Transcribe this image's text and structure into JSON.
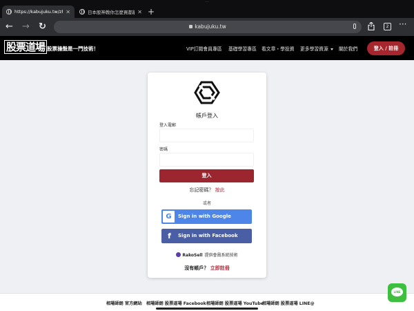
{
  "browser": {
    "tabs": [
      {
        "title": "https://kabujuku.tw/zh/m"
      },
      {
        "title": "日本股神教你怎麼買都能賺"
      }
    ],
    "new_tab": "+",
    "back": "←",
    "forward": "→",
    "reload": "↻",
    "url": "kabujuku.tw",
    "tab_count": "2",
    "more": "···"
  },
  "site": {
    "logo": "股票道場",
    "slogan": "股票操盤是一門技術！",
    "nav": [
      {
        "label": "VIP訂閱會員專區"
      },
      {
        "label": "基礎學習專區"
      },
      {
        "label": "看文章・學投資"
      },
      {
        "label": "更多學習資源"
      },
      {
        "label": "關於我們"
      }
    ],
    "login_button": "登入 / 註冊"
  },
  "login": {
    "title": "帳戶登入",
    "email_label": "登入電郵",
    "email_value": "",
    "password_label": "密碼",
    "password_value": "",
    "submit": "登入",
    "forgot_text": "忘記密碼？",
    "forgot_link": "按此",
    "or": "或者",
    "google": "Sign in with Google",
    "google_icon": "G",
    "facebook": "Sign in with Facebook",
    "facebook_icon": "f",
    "powered_name": "RakoSell",
    "powered_text": "提供會員系統技術",
    "no_account": "沒有帳戶？",
    "register_link": "立即註冊"
  },
  "footer": {
    "links": [
      {
        "label": "相場師朗 官方網站"
      },
      {
        "label": "相場師朗 股票道場 Facebook"
      },
      {
        "label": "相場師朗 股票道場 YouTube"
      },
      {
        "label": "相場師朗 股票道場 LINE@"
      }
    ],
    "line_badge": "LINE"
  },
  "colors": {
    "brand_red": "#a5262c",
    "google_blue": "#4d86e8",
    "facebook_blue": "#4a5ea6",
    "line_green": "#3fbf3f"
  }
}
